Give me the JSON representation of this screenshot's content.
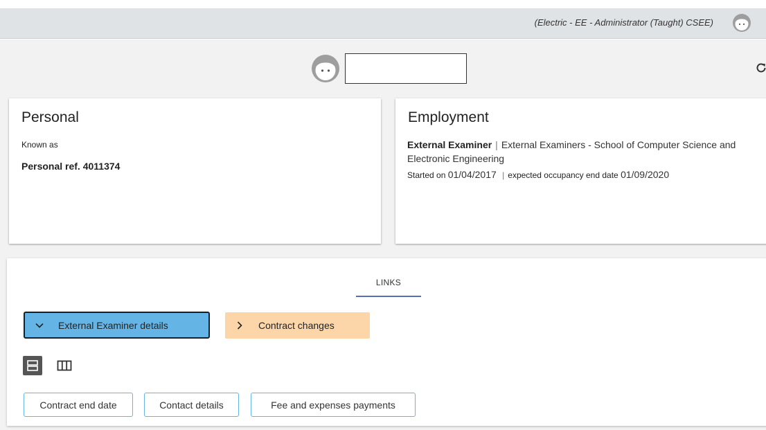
{
  "header": {
    "role_text": "(Electric - EE - Administrator (Taught) CSEE)",
    "user_avatar_icon": "face-avatar-icon"
  },
  "profile": {
    "avatar_icon": "face-avatar-icon",
    "name_value": "",
    "refresh_icon": "refresh-icon"
  },
  "personal": {
    "title": "Personal",
    "known_as_label": "Known as",
    "personal_ref": "Personal ref. 4011374"
  },
  "employment": {
    "title": "Employment",
    "role": "External Examiner",
    "separator": "|",
    "department": "External Examiners - School of Computer Science and Electronic Engineering",
    "started_label": "Started on",
    "started_date": "01/04/2017",
    "end_label": "expected occupancy end date",
    "end_date": "01/09/2020"
  },
  "links": {
    "tab_label": "LINKS",
    "accordion": [
      {
        "label": "External Examiner details",
        "icon": "chevron-down-icon",
        "expanded": true,
        "color": "#64b5e6"
      },
      {
        "label": "Contract changes",
        "icon": "chevron-right-icon",
        "expanded": false,
        "color": "#fcd6a8"
      }
    ],
    "view_toggles": [
      {
        "icon": "list-view-icon",
        "selected": true
      },
      {
        "icon": "column-view-icon",
        "selected": false
      }
    ],
    "chips": [
      "Contract end date",
      "Contact details",
      "Fee and expenses payments"
    ]
  },
  "colors": {
    "topbar": "#dfe3e6",
    "background": "#f2f2f2",
    "accent_blue": "#64b5e6",
    "accent_orange": "#fcd6a8",
    "tab_underline": "#5b6db5"
  }
}
